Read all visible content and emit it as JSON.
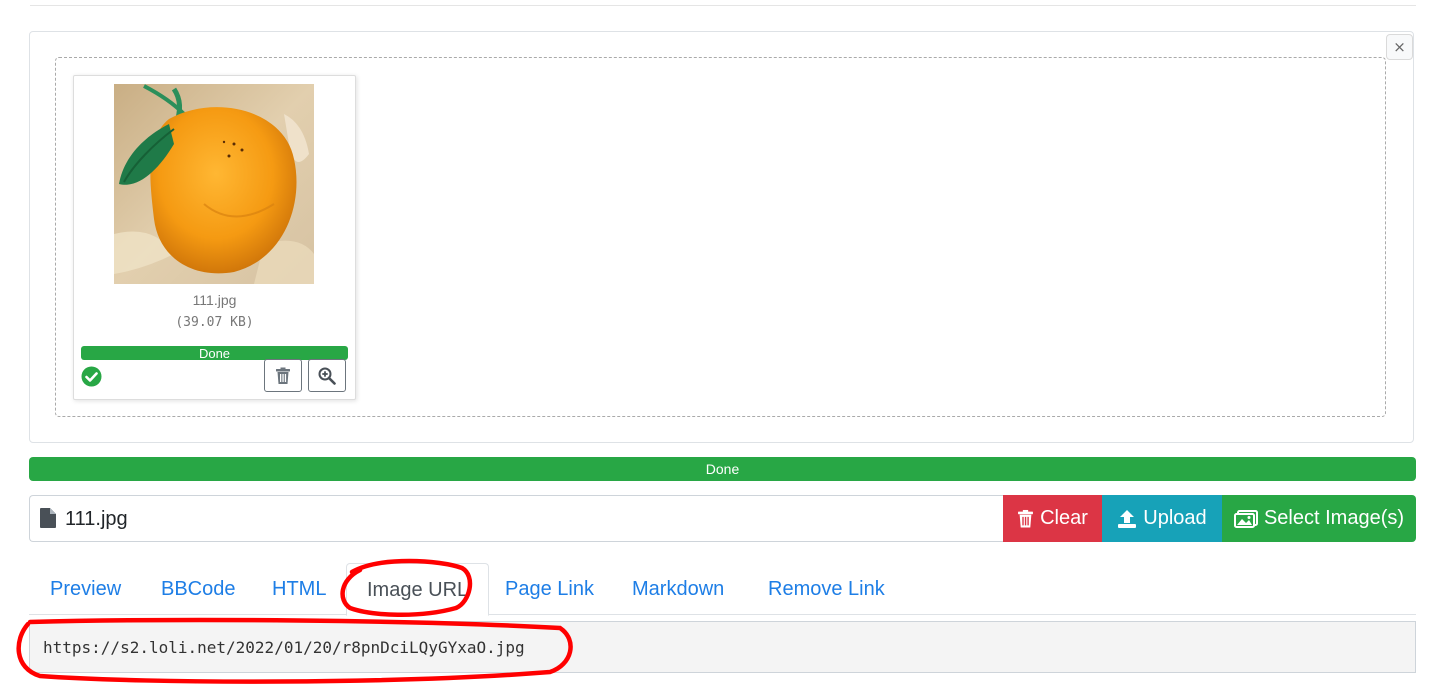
{
  "uploader": {
    "close_label": "×",
    "thumbnail": {
      "file_name": "111.jpg",
      "file_size": "(39.07 KB)",
      "progress_text": "Done",
      "progress_percent": 100,
      "status_icon": "check-circle-icon",
      "delete_icon": "trash-icon",
      "zoom_icon": "zoom-in-icon"
    },
    "overall_progress_text": "Done",
    "overall_progress_percent": 100,
    "caption": {
      "file_icon": "file-icon",
      "file_name": "111.jpg"
    },
    "buttons": {
      "clear_label": "Clear",
      "upload_label": "Upload",
      "select_label": "Select Image(s)"
    }
  },
  "tabs": [
    {
      "label": "Preview"
    },
    {
      "label": "BBCode"
    },
    {
      "label": "HTML"
    },
    {
      "label": "Image URL",
      "active": true
    },
    {
      "label": "Page Link"
    },
    {
      "label": "Markdown"
    },
    {
      "label": "Remove Link"
    }
  ],
  "output": {
    "url": "https://s2.loli.net/2022/01/20/r8pnDciLQyGYxaO.jpg"
  },
  "colors": {
    "success": "#28a745",
    "danger": "#dc3545",
    "info": "#17a2b8",
    "link": "#1e7ee6",
    "annotation": "#ff0000"
  }
}
